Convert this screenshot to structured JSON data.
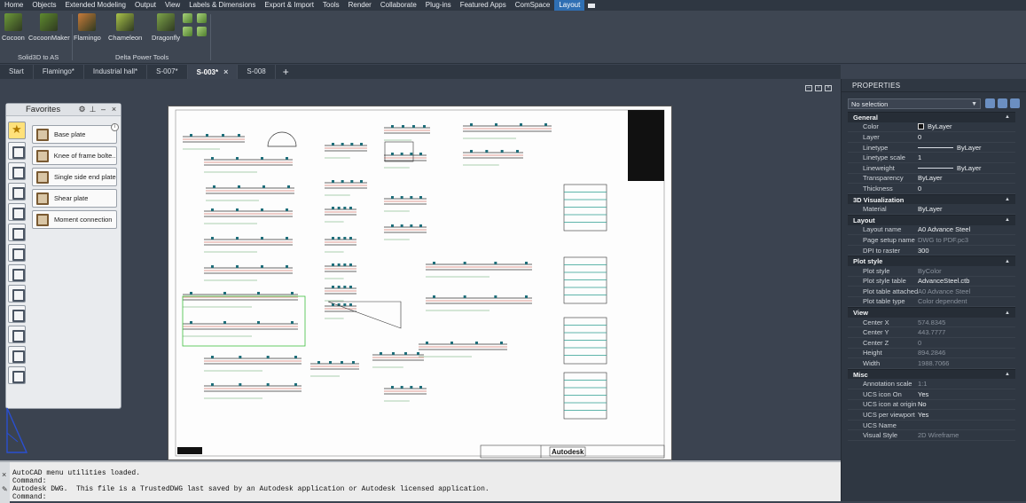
{
  "menu": {
    "items": [
      "Home",
      "Objects",
      "Extended Modeling",
      "Output",
      "View",
      "Labels & Dimensions",
      "Export & Import",
      "Tools",
      "Render",
      "Collaborate",
      "Plug-ins",
      "Featured Apps",
      "ComSpace",
      "Layout"
    ],
    "active": "Layout"
  },
  "ribbon": {
    "buttons": [
      {
        "label": "Cocoon",
        "color": "#6d9a3a"
      },
      {
        "label": "CocoonMaker",
        "color": "#5e8a2f"
      },
      {
        "label": "Flamingo",
        "color": "#c87b3a"
      },
      {
        "label": "Chameleon",
        "color": "#a9c24a"
      },
      {
        "label": "Dragonfly",
        "color": "#7ea44a"
      }
    ],
    "panels": [
      "Solid3D to AS",
      "Delta Power Tools"
    ]
  },
  "tabs": {
    "items": [
      "Start",
      "Flamingo*",
      "Industrial hall*",
      "S-007*",
      "S-003*",
      "S-008"
    ],
    "active": "S-003*",
    "plus": "+"
  },
  "favorites": {
    "title": "Favorites",
    "items": [
      "Base plate",
      "Knee of frame bolte...",
      "Single side end plate",
      "Shear plate",
      "Moment connection"
    ]
  },
  "drawing": {
    "title_block_brand": "Autodesk"
  },
  "command_lines": [
    "AutoCAD menu utilities loaded.",
    "Command:",
    "Autodesk DWG.  This file is a TrustedDWG last saved by an Autodesk application or Autodesk licensed application.",
    "Command:"
  ],
  "properties": {
    "title": "PROPERTIES",
    "selection": "No selection",
    "sections": [
      {
        "name": "General",
        "rows": [
          {
            "label": "Color",
            "value": "ByLayer",
            "swatch": "#111111"
          },
          {
            "label": "Layer",
            "value": "0"
          },
          {
            "label": "Linetype",
            "value": "ByLayer",
            "line": true
          },
          {
            "label": "Linetype scale",
            "value": "1"
          },
          {
            "label": "Lineweight",
            "value": "ByLayer",
            "line": true
          },
          {
            "label": "Transparency",
            "value": "ByLayer"
          },
          {
            "label": "Thickness",
            "value": "0"
          }
        ]
      },
      {
        "name": "3D Visualization",
        "rows": [
          {
            "label": "Material",
            "value": "ByLayer"
          }
        ]
      },
      {
        "name": "Layout",
        "rows": [
          {
            "label": "Layout name",
            "value": "A0 Advance Steel"
          },
          {
            "label": "Page setup name",
            "value": "DWG to PDF.pc3",
            "dim": true
          },
          {
            "label": "DPI to raster",
            "value": "300"
          }
        ]
      },
      {
        "name": "Plot style",
        "rows": [
          {
            "label": "Plot style",
            "value": "ByColor",
            "dim": true
          },
          {
            "label": "Plot style table",
            "value": "AdvanceSteel.ctb"
          },
          {
            "label": "Plot table attached to",
            "value": "A0 Advance Steel",
            "dim": true
          },
          {
            "label": "Plot table type",
            "value": "Color dependent",
            "dim": true
          }
        ]
      },
      {
        "name": "View",
        "rows": [
          {
            "label": "Center X",
            "value": "574.8345",
            "dim": true
          },
          {
            "label": "Center Y",
            "value": "443.7777",
            "dim": true
          },
          {
            "label": "Center Z",
            "value": "0",
            "dim": true
          },
          {
            "label": "Height",
            "value": "894.2846",
            "dim": true
          },
          {
            "label": "Width",
            "value": "1988.7066",
            "dim": true
          }
        ]
      },
      {
        "name": "Misc",
        "rows": [
          {
            "label": "Annotation scale",
            "value": "1:1",
            "dim": true
          },
          {
            "label": "UCS icon On",
            "value": "Yes"
          },
          {
            "label": "UCS icon at origin",
            "value": "No"
          },
          {
            "label": "UCS per viewport",
            "value": "Yes"
          },
          {
            "label": "UCS Name",
            "value": ""
          },
          {
            "label": "Visual Style",
            "value": "2D Wireframe",
            "dim": true
          }
        ]
      }
    ]
  }
}
